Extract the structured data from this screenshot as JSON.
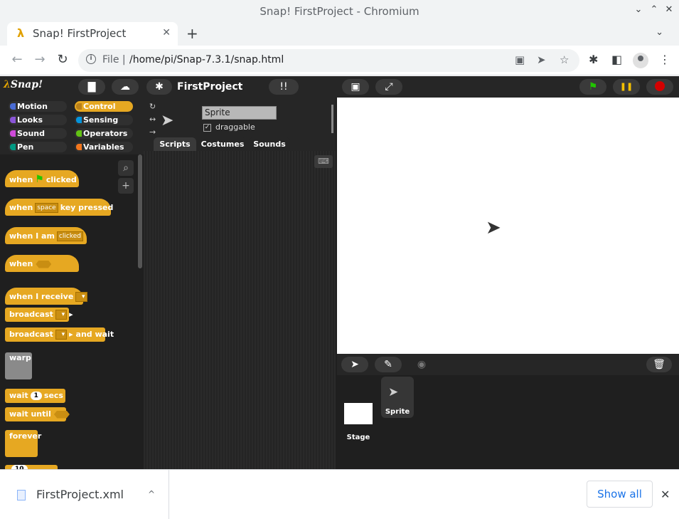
{
  "window": {
    "title": "Snap! FirstProject - Chromium",
    "minimize_glyph": "⌄",
    "maximize_glyph": "⌃",
    "close_glyph": "✕"
  },
  "tab": {
    "favicon": "λ",
    "title": "Snap! FirstProject",
    "close_glyph": "✕",
    "new_tab_glyph": "+",
    "menu_glyph": "⌄"
  },
  "toolbar": {
    "back_glyph": "←",
    "forward_glyph": "→",
    "reload_glyph": "↻",
    "scheme": "File",
    "separator": "|",
    "url": "/home/pi/Snap-7.3.1/snap.html",
    "info_glyph": "i",
    "blocked_glyph": "▣",
    "send_glyph": "➤",
    "star_glyph": "☆",
    "extensions_glyph": "✱",
    "sidepanel_glyph": "◧",
    "menu_glyph": "⋮"
  },
  "snap": {
    "logo_lambda": "λ",
    "logo_text": "Snap!",
    "file_glyph": "▇",
    "cloud_glyph": "☁",
    "settings_glyph": "✱",
    "project_name": "FirstProject",
    "unused_glyph": "!!",
    "stage_size_glyph": "▣",
    "fullscreen_glyph": "⤢",
    "flag_glyph": "⚑",
    "pause_glyph": "❚❚",
    "categories": [
      {
        "label": "Motion",
        "color": "#4a6cd4"
      },
      {
        "label": "Control",
        "color": "#e6a822"
      },
      {
        "label": "Looks",
        "color": "#8a55d7"
      },
      {
        "label": "Sensing",
        "color": "#0494dc"
      },
      {
        "label": "Sound",
        "color": "#cf4ad9"
      },
      {
        "label": "Operators",
        "color": "#62c213"
      },
      {
        "label": "Pen",
        "color": "#009982"
      },
      {
        "label": "Variables",
        "color": "#f3761d"
      }
    ],
    "palette": {
      "search_glyph": "⌕",
      "add_glyph": "+",
      "blocks": {
        "when_flag_1": "when",
        "when_flag_2": "clicked",
        "when_key_1": "when",
        "when_key_slot": "space",
        "when_key_2": "key pressed",
        "when_clicked_1": "when I am",
        "when_clicked_slot": "clicked",
        "when_cond": "when",
        "when_receive": "when I receive",
        "broadcast": "broadcast",
        "broadcast_wait_1": "broadcast",
        "broadcast_wait_2": "and wait",
        "warp": "warp",
        "wait": "wait",
        "wait_num": "1",
        "wait_secs": "secs",
        "wait_until": "wait until",
        "forever": "forever",
        "repeat_num": "10"
      }
    },
    "sprite": {
      "name": "Sprite",
      "draggable_label": "draggable",
      "draggable_check": "✓",
      "rotate_glyph": "↻",
      "flip_glyph": "↔",
      "none_glyph": "→",
      "arrow_glyph": "➤"
    },
    "tabs": [
      "Scripts",
      "Costumes",
      "Sounds"
    ],
    "keyboard_glyph": "⌨",
    "corral": {
      "turtle_glyph": "➤",
      "paint_glyph": "✎",
      "camera_glyph": "◉",
      "trash_glyph": "🗑",
      "stage_label": "Stage",
      "sprite_label": "Sprite"
    }
  },
  "download": {
    "filename": "FirstProject.xml",
    "chevron": "^",
    "show_all": "Show all",
    "close_glyph": "✕"
  }
}
